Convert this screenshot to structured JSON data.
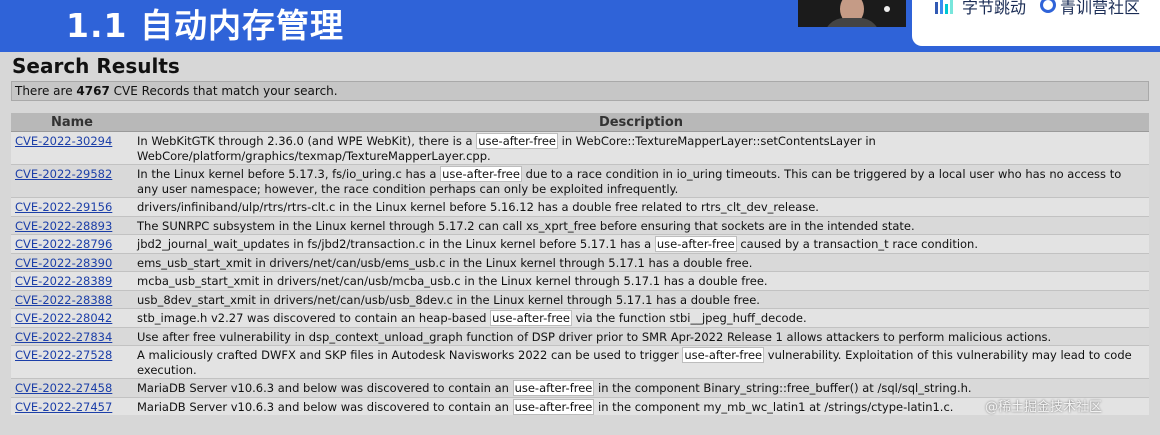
{
  "slide": {
    "title": "1.1 自动内存管理",
    "brand_left": "字节跳动",
    "brand_right": "青训营社区"
  },
  "page": {
    "heading": "Search Results",
    "count_prefix": "There are",
    "count": "4767",
    "count_suffix": "CVE Records that match your search."
  },
  "table": {
    "columns": [
      "Name",
      "Description"
    ],
    "highlight_term": "use-after-free",
    "rows": [
      {
        "id": "CVE-2022-30294",
        "description": "In WebKitGTK through 2.36.0 (and WPE WebKit), there is a use-after-free in WebCore::TextureMapperLayer::setContentsLayer in WebCore/platform/graphics/texmap/TextureMapperLayer.cpp."
      },
      {
        "id": "CVE-2022-29582",
        "description": "In the Linux kernel before 5.17.3, fs/io_uring.c has a use-after-free due to a race condition in io_uring timeouts. This can be triggered by a local user who has no access to any user namespace; however, the race condition perhaps can only be exploited infrequently."
      },
      {
        "id": "CVE-2022-29156",
        "description": "drivers/infiniband/ulp/rtrs/rtrs-clt.c in the Linux kernel before 5.16.12 has a double free related to rtrs_clt_dev_release."
      },
      {
        "id": "CVE-2022-28893",
        "description": "The SUNRPC subsystem in the Linux kernel through 5.17.2 can call xs_xprt_free before ensuring that sockets are in the intended state."
      },
      {
        "id": "CVE-2022-28796",
        "description": "jbd2_journal_wait_updates in fs/jbd2/transaction.c in the Linux kernel before 5.17.1 has a use-after-free caused by a transaction_t race condition."
      },
      {
        "id": "CVE-2022-28390",
        "description": "ems_usb_start_xmit in drivers/net/can/usb/ems_usb.c in the Linux kernel through 5.17.1 has a double free."
      },
      {
        "id": "CVE-2022-28389",
        "description": "mcba_usb_start_xmit in drivers/net/can/usb/mcba_usb.c in the Linux kernel through 5.17.1 has a double free."
      },
      {
        "id": "CVE-2022-28388",
        "description": "usb_8dev_start_xmit in drivers/net/can/usb/usb_8dev.c in the Linux kernel through 5.17.1 has a double free."
      },
      {
        "id": "CVE-2022-28042",
        "description": "stb_image.h v2.27 was discovered to contain an heap-based use-after-free via the function stbi__jpeg_huff_decode."
      },
      {
        "id": "CVE-2022-27834",
        "description": "Use after free vulnerability in dsp_context_unload_graph function of DSP driver prior to SMR Apr-2022 Release 1 allows attackers to perform malicious actions."
      },
      {
        "id": "CVE-2022-27528",
        "description": "A maliciously crafted DWFX and SKP files in Autodesk Navisworks 2022 can be used to trigger use-after-free vulnerability. Exploitation of this vulnerability may lead to code execution."
      },
      {
        "id": "CVE-2022-27458",
        "description": "MariaDB Server v10.6.3 and below was discovered to contain an use-after-free in the component Binary_string::free_buffer() at /sql/sql_string.h."
      },
      {
        "id": "CVE-2022-27457",
        "description": "MariaDB Server v10.6.3 and below was discovered to contain an use-after-free in the component my_mb_wc_latin1 at /strings/ctype-latin1.c."
      }
    ]
  },
  "watermark": "@稀土掘金技术社区",
  "colors": {
    "slide_blue": "#2f63d8",
    "link": "#1c3fa8"
  }
}
